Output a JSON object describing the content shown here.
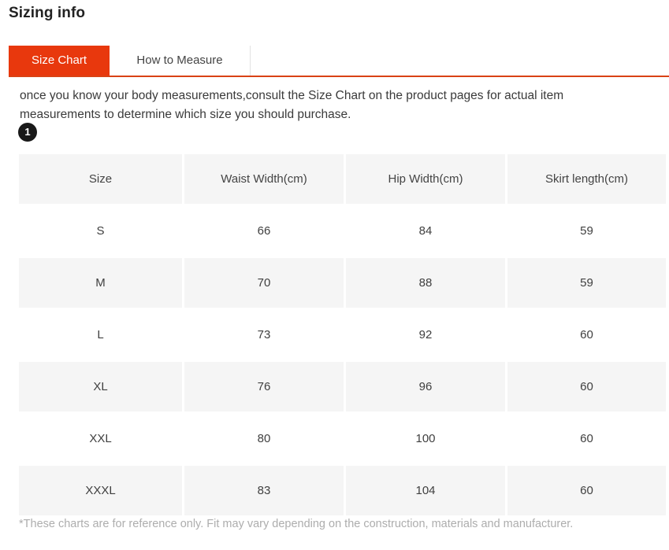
{
  "page": {
    "title": "Sizing info"
  },
  "tabs": {
    "items": [
      {
        "label": "Size Chart",
        "active": true
      },
      {
        "label": "How to Measure",
        "active": false
      }
    ],
    "active_color": "#e8380d",
    "underline_color": "#d94215"
  },
  "intro": {
    "text": "once you know your body measurements,consult the Size Chart on the product pages for actual item measurements to determine which size you should purchase."
  },
  "step_badge": {
    "label": "1",
    "background": "#191919",
    "color": "#ffffff"
  },
  "chart_data": {
    "type": "table",
    "title": "Sizing info",
    "columns": [
      "Size",
      "Waist Width(cm)",
      "Hip Width(cm)",
      "Skirt length(cm)"
    ],
    "rows": [
      [
        "S",
        "66",
        "84",
        "59"
      ],
      [
        "M",
        "70",
        "88",
        "59"
      ],
      [
        "L",
        "73",
        "92",
        "60"
      ],
      [
        "XL",
        "76",
        "96",
        "60"
      ],
      [
        "XXL",
        "80",
        "100",
        "60"
      ],
      [
        "XXXL",
        "83",
        "104",
        "60"
      ]
    ]
  },
  "footnote": {
    "text": "*These charts are for reference only. Fit may vary depending on the construction, materials and manufacturer."
  }
}
